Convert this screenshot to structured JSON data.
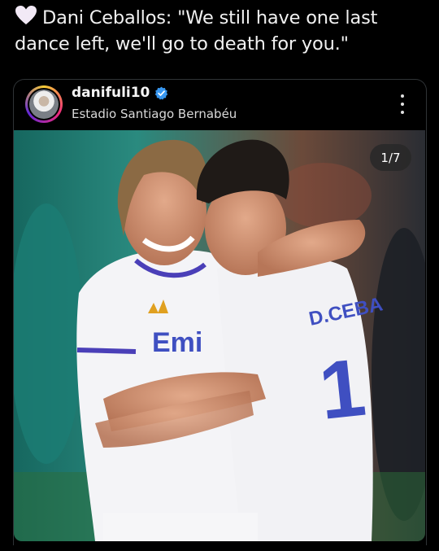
{
  "tweet": {
    "text": "Dani Ceballos: \"We still have one last dance left, we'll go to death for you.\"",
    "heart_color": "#f2e9f6"
  },
  "post": {
    "username": "danifuli10",
    "location": "Estadio Santiago Bernabéu",
    "verified_color": "#3897f0",
    "image_counter": "1/7",
    "image_description_icon": "photo-two-players-embracing",
    "jersey_texts": {
      "front": "Emi",
      "back": "D.CEBA",
      "number": "1"
    }
  },
  "colors": {
    "background": "#000000",
    "text": "#f1f1f1",
    "kit_white": "#f4f4f7",
    "kit_purple": "#4a3fb8",
    "pitch_teal": "#1e8f86"
  }
}
